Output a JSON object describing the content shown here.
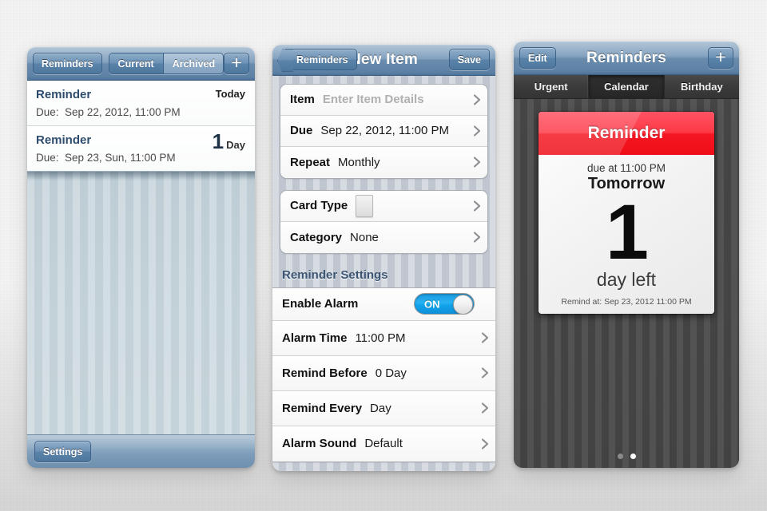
{
  "screens": {
    "left": {
      "nav": {
        "back_label": "Reminders",
        "segments": [
          {
            "label": "Current",
            "active": false
          },
          {
            "label": "Archived",
            "active": true
          }
        ],
        "add_icon": "plus-icon",
        "add_label": "+"
      },
      "list": [
        {
          "title": "Reminder",
          "due_prefix": "Due:",
          "due_value": "Sep 22, 2012, 11:00 PM",
          "badge_text": "Today",
          "badge_number": "",
          "badge_unit": ""
        },
        {
          "title": "Reminder",
          "due_prefix": "Due:",
          "due_value": "Sep 23, Sun, 11:00 PM",
          "badge_text": "",
          "badge_number": "1",
          "badge_unit": "Day"
        }
      ],
      "toolbar": {
        "settings_label": "Settings"
      }
    },
    "middle": {
      "nav": {
        "back_label": "Reminders",
        "title": "New Item",
        "save_label": "Save"
      },
      "group_one": [
        {
          "label": "Item",
          "value": "Enter Item Details",
          "is_placeholder": true
        },
        {
          "label": "Due",
          "value": "Sep 22, 2012, 11:00 PM",
          "is_placeholder": false
        },
        {
          "label": "Repeat",
          "value": "Monthly",
          "is_placeholder": false
        }
      ],
      "group_two": [
        {
          "label": "Card Type",
          "value": "",
          "icon": "calendar-card-icon"
        },
        {
          "label": "Category",
          "value": "None",
          "icon": ""
        }
      ],
      "section_title": "Reminder Settings",
      "settings": [
        {
          "label": "Enable Alarm",
          "value": "",
          "control": "toggle",
          "toggle_label": "ON",
          "toggle_on": true
        },
        {
          "label": "Alarm Time",
          "value": "11:00 PM",
          "control": "chevron"
        },
        {
          "label": "Remind Before",
          "value": "0 Day",
          "control": "chevron"
        },
        {
          "label": "Remind Every",
          "value": "Day",
          "control": "chevron"
        },
        {
          "label": "Alarm Sound",
          "value": "Default",
          "control": "chevron"
        }
      ]
    },
    "right": {
      "nav": {
        "edit_label": "Edit",
        "title": "Reminders",
        "add_label": "+"
      },
      "tabs": [
        {
          "label": "Urgent",
          "active": false
        },
        {
          "label": "Calendar",
          "active": true
        },
        {
          "label": "Birthday",
          "active": false
        }
      ],
      "card": {
        "header": "Reminder",
        "due_line": "due at 11:00 PM",
        "when": "Tomorrow",
        "number": "1",
        "unit": "day left",
        "footer": "Remind at: Sep 23, 2012 11:00 PM"
      },
      "pager": {
        "count": 2,
        "active_index": 1
      }
    }
  },
  "colors": {
    "nav_blue": "#6b8dae",
    "accent_red": "#f41622",
    "toggle_blue": "#13a4ec",
    "dark_tab": "#343434",
    "list_title": "#2e4c6d"
  }
}
